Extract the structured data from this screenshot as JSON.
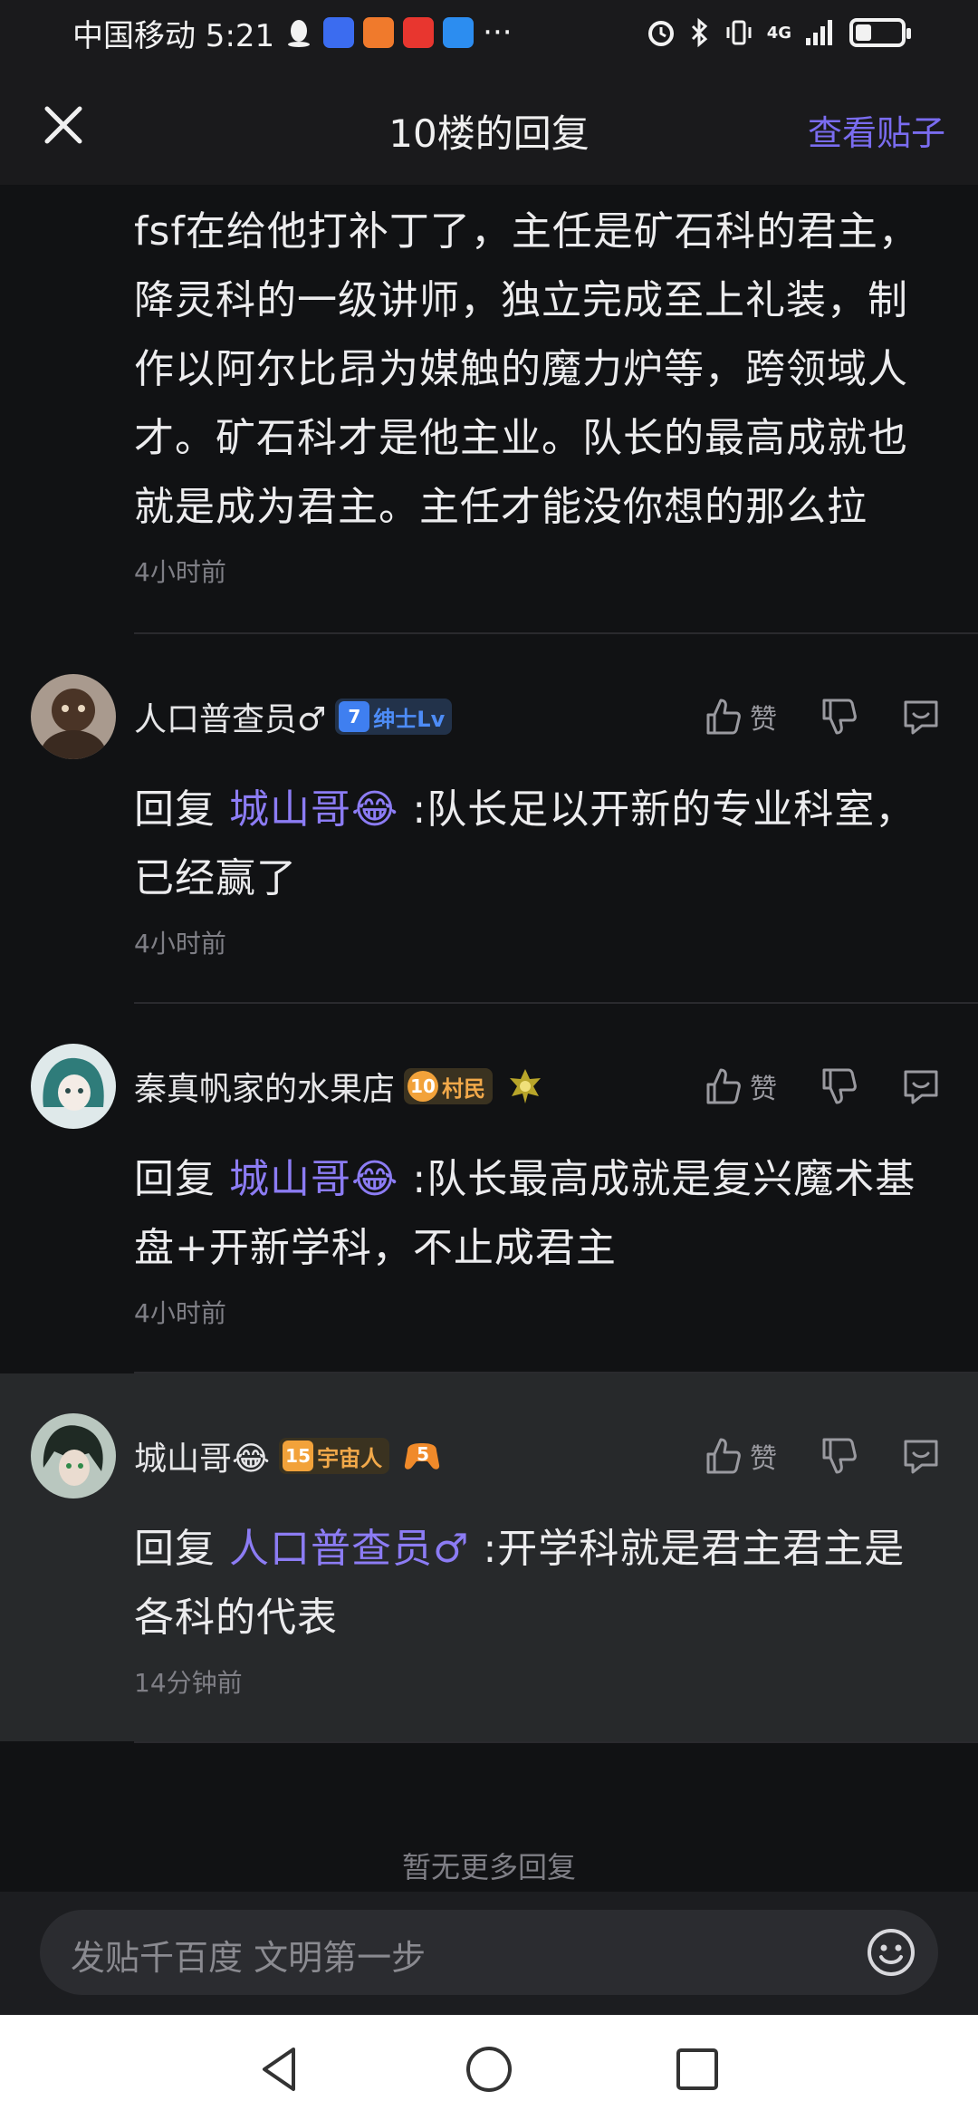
{
  "status_bar": {
    "carrier_time": "中国移动 5:21",
    "more": "···",
    "network": "4G"
  },
  "header": {
    "close_icon": "close-icon",
    "title": "10楼的回复",
    "view_post": "查看贴子"
  },
  "first_reply": {
    "text": "fsf在给他打补丁了，主任是矿石科的君主，降灵科的一级讲师，独立完成至上礼装，制作以阿尔比昂为媒触的魔力炉等，跨领域人才。矿石科才是他主业。队长的最高成就也就是成为君主。主任才能没你想的那么拉",
    "time": "4小时前"
  },
  "actions": {
    "like_label": "赞"
  },
  "comments": [
    {
      "username": "人口普查员♂",
      "badge_level": "7",
      "badge_title": "绅士Lv",
      "reply_prefix": "回复",
      "mention": "城山哥😂",
      "text": " :队长足以开新的专业科室，已经赢了",
      "time": "4小时前"
    },
    {
      "username": "秦真帆家的水果店",
      "badge_level": "10",
      "badge_title": "村民",
      "reply_prefix": "回复",
      "mention": "城山哥😂",
      "text": " :队长最高成就是复兴魔术基盘+开新学科，不止成君主",
      "time": "4小时前"
    },
    {
      "username": "城山哥😂",
      "badge_level": "15",
      "badge_title": "宇宙人",
      "extra_badge": "5",
      "reply_prefix": "回复",
      "mention": "人口普查员♂",
      "text": " :开学科就是君主君主是各科的代表",
      "time": "14分钟前"
    }
  ],
  "no_more": "暂无更多回复",
  "input": {
    "placeholder": "发贴千百度 文明第一步"
  },
  "colors": {
    "accent": "#8c7cf4",
    "background": "#111214",
    "highlight_row": "#27292b"
  }
}
